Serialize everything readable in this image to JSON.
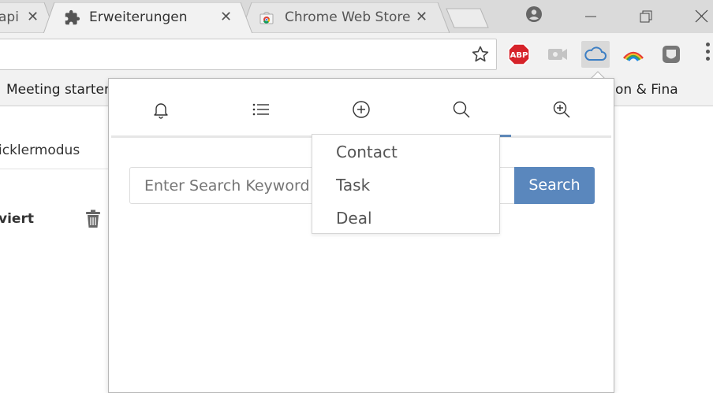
{
  "tabs": [
    {
      "title": "api",
      "close": "✕"
    },
    {
      "title": "Erweiterungen",
      "close": "✕",
      "active": true
    },
    {
      "title": "Chrome Web Store",
      "close": "✕"
    }
  ],
  "extensions": {
    "abp_label": "ABP"
  },
  "bookmarks": [
    {
      "label": "Meeting starten"
    },
    {
      "label": "on & Fina"
    }
  ],
  "page": {
    "devmode_label": "icklermodus",
    "item_status": "viert"
  },
  "popup": {
    "search_placeholder": "Enter Search Keyword",
    "search_button": "Search",
    "dropdown_items": [
      "Contact",
      "Task",
      "Deal"
    ],
    "active_nav": "search",
    "accent_color": "#5a87bd"
  }
}
